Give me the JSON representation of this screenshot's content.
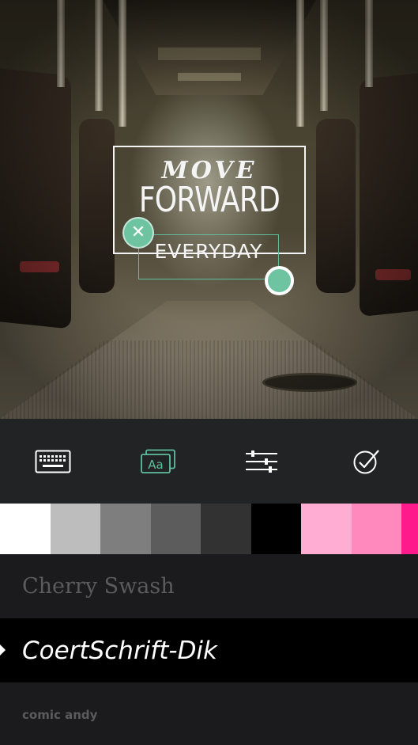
{
  "overlay": {
    "line1": "MOVE",
    "line2": "FORWARD",
    "line3": "EVERYDAY"
  },
  "toolbar": {
    "items": [
      {
        "icon": "keyboard-icon",
        "active": false
      },
      {
        "icon": "font-style-icon",
        "label": "Aa",
        "active": true
      },
      {
        "icon": "sliders-icon",
        "active": false
      },
      {
        "icon": "checkmark-icon",
        "active": false
      }
    ],
    "accent_color": "#5fbf9c"
  },
  "colors": [
    "#ffffff",
    "#bdbdbd",
    "#7e7e7e",
    "#5c5c5c",
    "#323232",
    "#000000",
    "#ffadd2",
    "#ff88bd",
    "#ff1a8c"
  ],
  "fonts": {
    "items": [
      {
        "label": "Cherry Swash"
      },
      {
        "label": "CoertSchrift-Dik"
      },
      {
        "label": "comic andy"
      }
    ],
    "selected_index": 1
  }
}
